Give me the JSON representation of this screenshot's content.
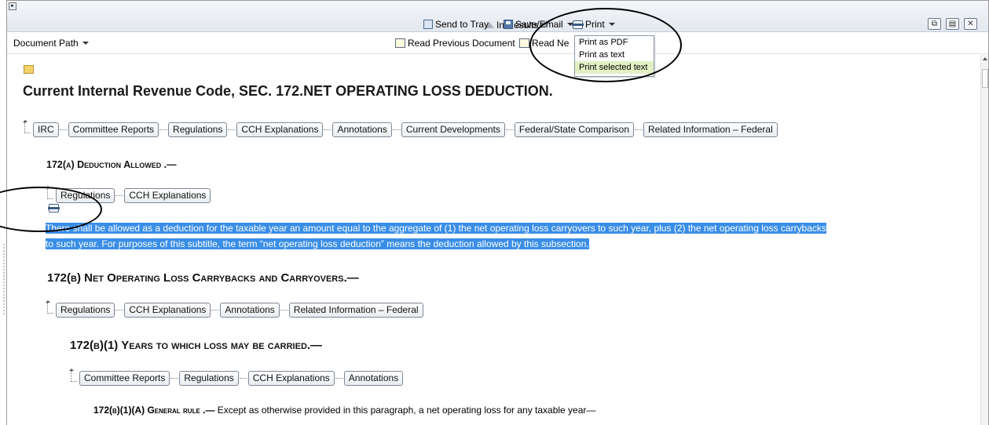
{
  "toolbar": {
    "in_results_label": "In Results",
    "send_to_tray_label": "Send to Tray",
    "save_email_label": "Save/Email",
    "print_label": "Print"
  },
  "docbar": {
    "document_path_label": "Document Path",
    "read_previous_label": "Read Previous Document",
    "read_next_label": "Read Ne"
  },
  "print_menu": {
    "items": [
      "Print as PDF",
      "Print as text",
      "Print selected text"
    ],
    "highlighted": "Print selected text"
  },
  "document": {
    "title": "Current Internal Revenue Code, SEC. 172.NET OPERATING LOSS DEDUCTION.",
    "top_links": [
      "IRC",
      "Committee Reports",
      "Regulations",
      "CCH Explanations",
      "Annotations",
      "Current Developments",
      "Federal/State Comparison",
      "Related Information – Federal"
    ],
    "sec_a": {
      "heading": "172(a) Deduction Allowed .—",
      "links": [
        "Regulations",
        "CCH Explanations"
      ],
      "text_line1": "There shall be allowed as a deduction for the taxable year an amount equal to the aggregate of (1) the net operating loss carryovers to such year, plus (2) the net operating loss carrybacks",
      "text_line2": "to such year. For purposes of this subtitle, the term “net operating loss deduction” means the deduction allowed by this subsection."
    },
    "sec_b": {
      "heading": "172(b) Net Operating Loss Carrybacks and Carryovers.—",
      "links": [
        "Regulations",
        "CCH Explanations",
        "Annotations",
        "Related Information – Federal"
      ]
    },
    "sec_b1": {
      "heading": "172(b)(1) Years to which loss may be carried.—",
      "links": [
        "Committee Reports",
        "Regulations",
        "CCH Explanations",
        "Annotations"
      ]
    },
    "sec_b1a": {
      "heading": "172(b)(1)(A) General rule .—",
      "text": "Except as otherwise provided in this paragraph, a net operating loss for any taxable year—"
    }
  },
  "colors": {
    "selection": "#3a8ee6",
    "menu_highlight": "#e2f0c4"
  }
}
